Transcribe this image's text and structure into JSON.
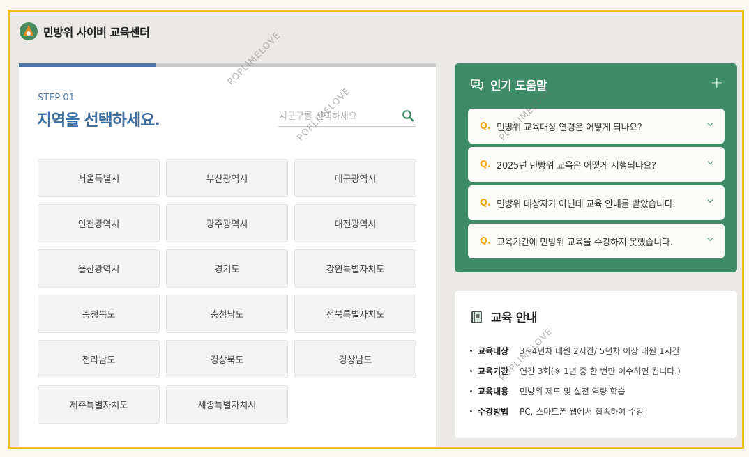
{
  "header": {
    "title": "민방위 사이버 교육센터"
  },
  "progress": {
    "fraction": 0.33
  },
  "step": {
    "label": "STEP 01",
    "title": "지역을 선택하세요.",
    "search_placeholder": "시군구를 선택하세요"
  },
  "regions": [
    "서울특별시",
    "부산광역시",
    "대구광역시",
    "인천광역시",
    "광주광역시",
    "대전광역시",
    "울산광역시",
    "경기도",
    "강원특별자치도",
    "충청북도",
    "충청남도",
    "전북특별자치도",
    "전라남도",
    "경상북도",
    "경상남도",
    "제주특별자치도",
    "세종특별자치시"
  ],
  "faq": {
    "title": "인기 도움말",
    "expand_symbol": "+",
    "q_mark": "Q.",
    "items": [
      "민방위 교육대상 연령은 어떻게 되나요?",
      "2025년 민방위 교육은 어떻게 시행되나요?",
      "민방위 대상자가 아닌데 교육 안내를 받았습니다.",
      "교육기간에 민방위 교육을 수강하지 못했습니다."
    ]
  },
  "info": {
    "title": "교육 안내",
    "rows": [
      {
        "label": "교육대상",
        "value": "3~4년차 대원 2시간/ 5년차 이상 대원 1시간"
      },
      {
        "label": "교육기간",
        "value": "연간 3회(※ 1년 중 한 번만 이수하면 됩니다.)"
      },
      {
        "label": "교육내용",
        "value": "민방위 제도 및 실전 역량 학습"
      },
      {
        "label": "수강방법",
        "value": "PC, 스마트폰 웹에서 접속하여 수강"
      }
    ]
  },
  "watermark": "POPLIMELOVE",
  "colors": {
    "accent_blue": "#4a76a8",
    "faq_green": "#3d8c67",
    "q_orange": "#f0a71a",
    "frame_yellow": "#f2bf1a"
  }
}
